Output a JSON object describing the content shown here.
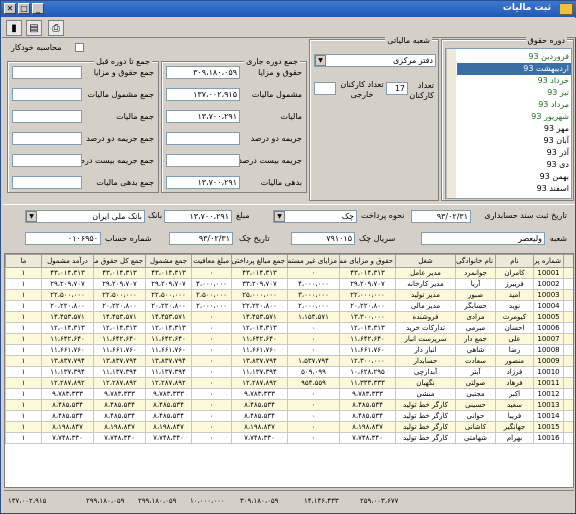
{
  "window": {
    "title": "ثبت مالیات"
  },
  "period_group": {
    "label": "دوره حقوق",
    "items": [
      "فروردین 93",
      "اردیبهشت 93",
      "خرداد 93",
      "تیر 93",
      "مرداد 93",
      "شهریور 93",
      "مهر 93",
      "آبان 93",
      "آذر 93",
      "دی 93",
      "بهمن 93",
      "اسفند 93"
    ]
  },
  "tax_branch": {
    "label": "شعبه مالیاتی",
    "value": "دفتر مرکزی",
    "employee_count_label": "تعداد کارکنان",
    "employee_count": "17",
    "foreign_count_label": "تعداد کارکنان خارجی",
    "foreign_count": ""
  },
  "current_period": {
    "label": "جمع دوره جاری",
    "rows": [
      {
        "label": "حقوق و مزایا",
        "value": "۳۰۹،۱۸۰،۰۵۹"
      },
      {
        "label": "مشمول مالیات",
        "value": "۱۳۷،۰۰۲،۹۱۵"
      },
      {
        "label": "مالیات",
        "value": "۱۳،۷۰۰،۲۹۱"
      },
      {
        "label": "جریمه دو درصد",
        "value": ""
      },
      {
        "label": "جریمه بیست درصد",
        "value": ""
      },
      {
        "label": "بدهی مالیات",
        "value": "۱۳،۷۰۰،۲۹۱"
      }
    ]
  },
  "previous_period": {
    "label": "جمع تا دوره قبل",
    "auto_calc_label": "محاسبه خودکار",
    "rows": [
      {
        "label": "جمع حقوق و مزایا",
        "value": ""
      },
      {
        "label": "جمع مشمول مالیات",
        "value": ""
      },
      {
        "label": "جمع مالیات",
        "value": ""
      },
      {
        "label": "جمع جریمه دو درصد",
        "value": ""
      },
      {
        "label": "جمع جریمه بیست درصد",
        "value": ""
      },
      {
        "label": "جمع بدهی مالیات",
        "value": ""
      }
    ]
  },
  "payment": {
    "doc_date_label": "تاریخ ثبت سند حسابداری",
    "doc_date": "۹۳/۰۲/۳۱",
    "pay_method_label": "نحوه پرداخت",
    "pay_method": "چک",
    "amount_label": "مبلغ",
    "amount": "۱۳،۷۰۰،۲۹۱",
    "bank_label": "بانک",
    "bank": "بانک ملی ایران",
    "branch_label": "شعبه",
    "branch": "ولیعصر",
    "check_serial_label": "سریال چک",
    "check_serial": "۷۹۱۰۱۵",
    "check_date_label": "تاریخ چک",
    "check_date": "۹۳/۰۲/۳۱",
    "account_label": "شماره حساب",
    "account": "۰۱۰۶۹۵۰"
  },
  "grid": {
    "columns": [
      "شماره پرسنلی",
      "نام",
      "نام خانوادگی",
      "شغل",
      "حقوق و مزایای مستمر",
      "مزایای غیر مستمر",
      "جمع مبالغ پرداختی",
      "مبلغ معافیت",
      "جمع مشمول",
      "جمع کل حقوق مشمول",
      "درآمد مشمول",
      "ما"
    ],
    "rows": [
      [
        "10001",
        "کامران",
        "جوانمرد",
        "مدیر عامل",
        "۴۳،۰۱۴،۳۱۳",
        "۰",
        "۴۳،۰۱۴،۳۱۳",
        "۰",
        "۴۳،۰۱۴،۳۱۳",
        "۴۳،۰۱۴،۳۱۳",
        "۴۳،۰۱۴،۳۱۳",
        "۱"
      ],
      [
        "10002",
        "فریبرز",
        "آریا",
        "مدیر کارخانه",
        "۲۹،۲۰۹،۷۰۷",
        "۴،۰۰۰،۰۰۰",
        "۳۳،۲۰۹،۷۰۷",
        "۴،۰۰۰،۰۰۰",
        "۲۹،۲۰۹،۷۰۷",
        "۲۹،۲۰۹،۷۰۷",
        "۲۹،۲۰۹،۷۰۷",
        "۱"
      ],
      [
        "10003",
        "امید",
        "صبور",
        "مدیر تولید",
        "۲۲،۰۰۰،۰۰۰",
        "۳،۰۰۰،۰۰۰",
        "۲۵،۰۰۰،۰۰۰",
        "۲،۵۰۰،۰۰۰",
        "۲۲،۵۰۰،۰۰۰",
        "۲۲،۵۰۰،۰۰۰",
        "۲۲،۵۰۰،۰۰۰",
        "۱"
      ],
      [
        "10004",
        "نوید",
        "حسابگر",
        "مدیر مالی",
        "۲۰،۲۲۰،۸۰۰",
        "۲،۰۰۰،۰۰۰",
        "۲۲،۲۲۰،۸۰۰",
        "۲،۰۰۰،۰۰۰",
        "۲۰،۲۲۰،۸۰۰",
        "۲۰،۲۲۰،۸۰۰",
        "۲۰،۲۲۰،۸۰۰",
        "۱"
      ],
      [
        "10005",
        "کیومرث",
        "مرادی",
        "فروشنده",
        "۱۳،۳۰۰،۰۰۰",
        "۱،۱۵۳،۵۷۱",
        "۱۴،۴۵۳،۵۷۱",
        "۰",
        "۱۴،۴۵۳،۵۷۱",
        "۱۴،۴۵۳،۵۷۱",
        "۱۴،۴۵۳،۵۷۱",
        "۱"
      ],
      [
        "10006",
        "احسان",
        "مبرمی",
        "تدارکات خرید",
        "۱۲،۰۱۴،۳۱۳",
        "۰",
        "۱۲،۰۱۴،۳۱۳",
        "۰",
        "۱۲،۰۱۴،۳۱۳",
        "۱۲،۰۱۴،۳۱۳",
        "۱۲،۰۱۴،۳۱۳",
        "۱"
      ],
      [
        "10007",
        "علی",
        "جمع دار",
        "سرپرست انبار",
        "۱۱،۶۴۲،۶۴۰",
        "۰",
        "۱۱،۶۴۲،۶۴۰",
        "۰",
        "۱۱،۶۴۲،۶۴۰",
        "۱۱،۶۴۲،۶۴۰",
        "۱۱،۶۴۲،۶۴۰",
        "۱"
      ],
      [
        "10008",
        "رضا",
        "شاهی",
        "انبار دار",
        "۱۱،۶۶۱،۷۶۰",
        "۰",
        "۱۱،۶۶۱،۷۶۰",
        "۰",
        "۱۱،۶۶۱،۷۶۰",
        "۱۱،۶۶۱،۷۶۰",
        "۱۱،۶۶۱،۷۶۰",
        "۱"
      ],
      [
        "10009",
        "منصور",
        "سعادت",
        "حسابدار",
        "۱۲،۳۰۰،۰۰۰",
        "۱،۵۳۷،۷۹۴",
        "۱۳،۸۳۷،۷۹۴",
        "۰",
        "۱۳،۸۳۷،۷۹۴",
        "۱۳،۸۳۷،۷۹۴",
        "۱۳،۸۳۷،۷۹۴",
        "۱"
      ],
      [
        "10010",
        "فرزاد",
        "آبتر",
        "آبدارچی",
        "۱۰،۶۲۸،۲۹۵",
        "۵۰۹،۰۹۹",
        "۱۱،۱۳۷،۳۹۴",
        "۰",
        "۱۱،۱۳۷،۳۹۴",
        "۱۱،۱۳۷،۳۹۴",
        "۱۱،۱۳۷،۳۹۴",
        "۱"
      ],
      [
        "10011",
        "فرهاد",
        "صولتی",
        "نگهبان",
        "۱۱،۳۳۳،۳۳۳",
        "۹۵۴،۵۵۹",
        "۱۲،۲۸۷،۸۹۲",
        "۰",
        "۱۲،۲۸۷،۸۹۲",
        "۱۲،۲۸۷،۸۹۲",
        "۱۲،۲۸۷،۸۹۲",
        "۱"
      ],
      [
        "10012",
        "اکبر",
        "مجتبی",
        "منشی",
        "۹،۷۸۳،۳۳۳",
        "۰",
        "۹،۷۸۳،۳۳۳",
        "۰",
        "۹،۷۸۳،۳۳۳",
        "۹،۷۸۳،۳۳۳",
        "۹،۷۸۳،۳۳۳",
        "۱"
      ],
      [
        "10013",
        "سعید",
        "حسینی",
        "کارگر خط تولید",
        "۸،۴۸۵،۵۳۴",
        "۰",
        "۸،۴۸۵،۵۳۴",
        "۰",
        "۸،۴۸۵،۵۳۴",
        "۸،۴۸۵،۵۳۴",
        "۸،۴۸۵،۵۳۴",
        "۱"
      ],
      [
        "10014",
        "فریبا",
        "جوانی",
        "کارگر خط تولید",
        "۸،۴۸۵،۵۳۴",
        "۰",
        "۸،۴۸۵،۵۳۴",
        "۰",
        "۸،۴۸۵،۵۳۴",
        "۸،۴۸۵،۵۳۴",
        "۸،۴۸۵،۵۳۴",
        "۱"
      ],
      [
        "10015",
        "جهانگیر",
        "کاشانی",
        "کارگر خط تولید",
        "۸،۱۹۸،۸۴۷",
        "۰",
        "۸،۱۹۸،۸۴۷",
        "۰",
        "۸،۱۹۸،۸۴۷",
        "۸،۱۹۸،۸۴۷",
        "۸،۱۹۸،۸۴۷",
        "۱"
      ],
      [
        "10016",
        "بهرام",
        "شهامتی",
        "کارگر خط تولید",
        "۷،۷۴۸،۳۴۰",
        "۰",
        "۷،۷۴۸،۳۴۰",
        "۰",
        "۷،۷۴۸،۳۴۰",
        "۷،۷۴۸،۳۴۰",
        "۷،۷۴۸،۳۴۰",
        "۱"
      ]
    ]
  },
  "footer": {
    "totals": [
      "۲۵۹،۰۰۳،۶۷۷",
      "۱۴،۱۴۶،۴۳۳",
      "۳۰۹،۱۸۰،۰۵۹",
      "۱۰،۰۰۰،۰۰۰",
      "۲۹۹،۱۸۰،۰۵۹",
      "۲۹۹،۱۸۰،۰۵۹",
      "۱۳۷،۰۰۲،۹۱۵"
    ]
  },
  "colors": {
    "title": "#2258b8",
    "selected": "#3a6ea5",
    "green_text": "#207020"
  }
}
